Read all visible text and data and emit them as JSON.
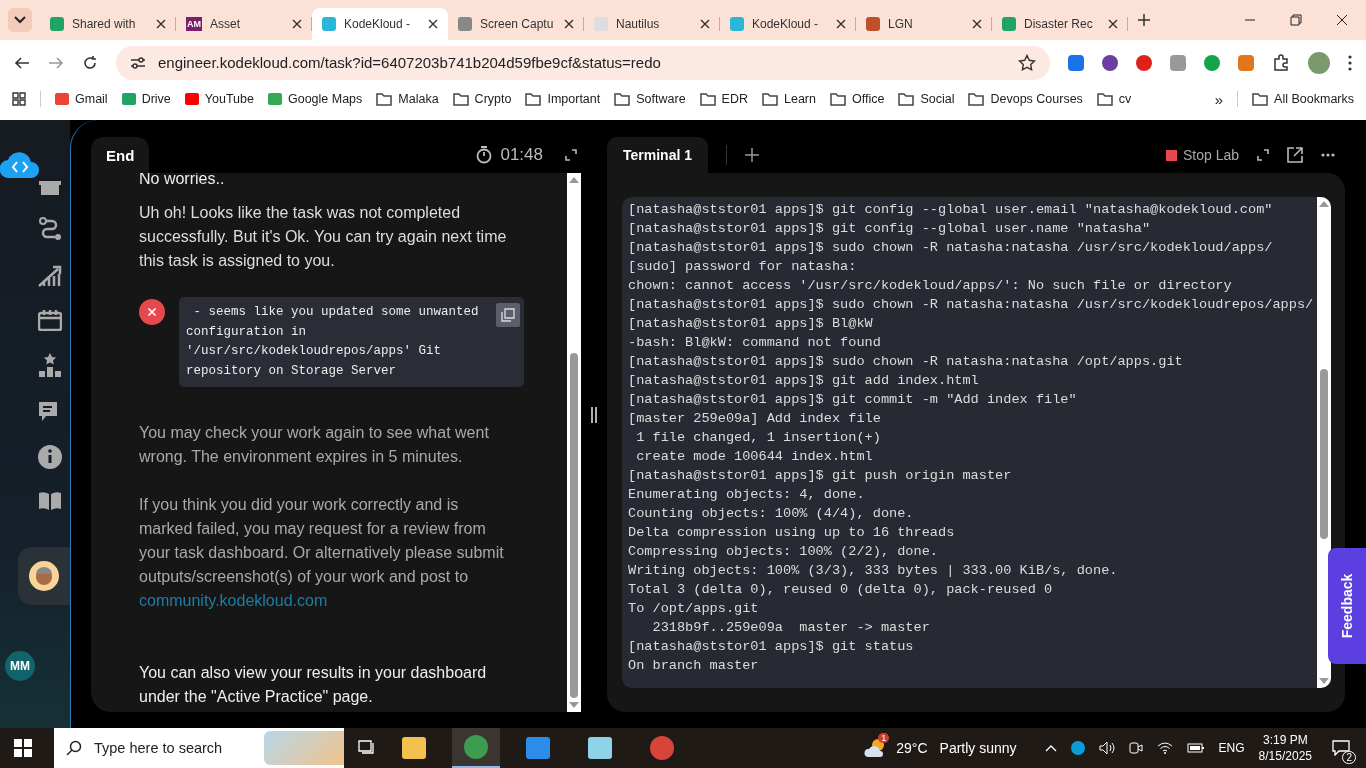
{
  "browser": {
    "tabs": [
      {
        "title": "Shared with",
        "selected": false,
        "color": "#1fa463"
      },
      {
        "title": "Asset",
        "selected": false,
        "color": "#7b1f6a"
      },
      {
        "title": "KodeKloud -",
        "selected": true,
        "color": "#29b6d8"
      },
      {
        "title": "Screen Captu",
        "selected": false,
        "color": "#888888"
      },
      {
        "title": "Nautilus",
        "selected": false,
        "color": "#dddddd"
      },
      {
        "title": "KodeKloud -",
        "selected": false,
        "color": "#29b6d8"
      },
      {
        "title": "LGN",
        "selected": false,
        "color": "#c0502a"
      },
      {
        "title": "Disaster Rec",
        "selected": false,
        "color": "#1fa463"
      }
    ],
    "favicon_text": "AM",
    "address": "engineer.kodekloud.com/task?id=6407203b741b204d59fbe9cf&status=redo",
    "bookmarks": [
      {
        "label": "Gmail",
        "kind": "site",
        "color": "#ea4335"
      },
      {
        "label": "Drive",
        "kind": "site",
        "color": "#1fa463"
      },
      {
        "label": "YouTube",
        "kind": "site",
        "color": "#ff0000"
      },
      {
        "label": "Google Maps",
        "kind": "site",
        "color": "#34a853"
      },
      {
        "label": "Malaka",
        "kind": "folder"
      },
      {
        "label": "Crypto",
        "kind": "folder"
      },
      {
        "label": "Important",
        "kind": "folder"
      },
      {
        "label": "Software",
        "kind": "folder"
      },
      {
        "label": "EDR",
        "kind": "folder"
      },
      {
        "label": "Learn",
        "kind": "folder"
      },
      {
        "label": "Office",
        "kind": "folder"
      },
      {
        "label": "Social",
        "kind": "folder"
      },
      {
        "label": "Devops Courses",
        "kind": "folder"
      },
      {
        "label": "cv",
        "kind": "folder"
      }
    ],
    "more_bookmarks": "»",
    "all_bookmarks": "All Bookmarks"
  },
  "sidebar": {
    "initials": "MM"
  },
  "task_panel": {
    "tab": "End",
    "timer": "01:48",
    "heading": "No worries..",
    "message": "Uh oh! Looks like the task was not completed successfully. But it's Ok. You can try again next time this task is assigned to you.",
    "error": " - seems like you updated some unwanted configuration in '/usr/src/kodekloudrepos/apps' Git repository on Storage Server",
    "note": "You may check your work again to see what went wrong. The environment expires in 5 minutes.",
    "help": "If you think you did your work correctly and is marked failed, you may request for a review from your task dashboard. Or alternatively please submit outputs/screenshot(s) of your work and post to",
    "link": "community.kodekloud.com",
    "footer": "You can also view your results in your dashboard under the \"Active Practice\" page."
  },
  "terminal": {
    "tabs": [
      {
        "label": "Terminal 1",
        "selected": true
      }
    ],
    "stop_label": "Stop Lab",
    "lines": [
      "[natasha@ststor01 apps]$ git config --global user.email \"natasha@kodekloud.com\"",
      "[natasha@ststor01 apps]$ git config --global user.name \"natasha\"",
      "[natasha@ststor01 apps]$ sudo chown -R natasha:natasha /usr/src/kodekloud/apps/",
      "[sudo] password for natasha:",
      "chown: cannot access '/usr/src/kodekloud/apps/': No such file or directory",
      "[natasha@ststor01 apps]$ sudo chown -R natasha:natasha /usr/src/kodekloudrepos/apps/",
      "[natasha@ststor01 apps]$ Bl@kW",
      "-bash: Bl@kW: command not found",
      "[natasha@ststor01 apps]$ sudo chown -R natasha:natasha /opt/apps.git",
      "[natasha@ststor01 apps]$ git add index.html",
      "[natasha@ststor01 apps]$ git commit -m \"Add index file\"",
      "[master 259e09a] Add index file",
      " 1 file changed, 1 insertion(+)",
      " create mode 100644 index.html",
      "[natasha@ststor01 apps]$ git push origin master",
      "Enumerating objects: 4, done.",
      "Counting objects: 100% (4/4), done.",
      "Delta compression using up to 16 threads",
      "Compressing objects: 100% (2/2), done.",
      "Writing objects: 100% (3/3), 333 bytes | 333.00 KiB/s, done.",
      "Total 3 (delta 0), reused 0 (delta 0), pack-reused 0",
      "To /opt/apps.git",
      "   2318b9f..259e09a  master -> master",
      "[natasha@ststor01 apps]$ git status",
      "On branch master"
    ]
  },
  "feedback": "Feedback",
  "taskbar": {
    "search_placeholder": "Type here to search",
    "weather_badge": "1",
    "temperature": "29°C",
    "weather": "Partly sunny",
    "language": "ENG",
    "time": "3:19 PM",
    "date": "8/15/2025",
    "notifications": "2"
  }
}
